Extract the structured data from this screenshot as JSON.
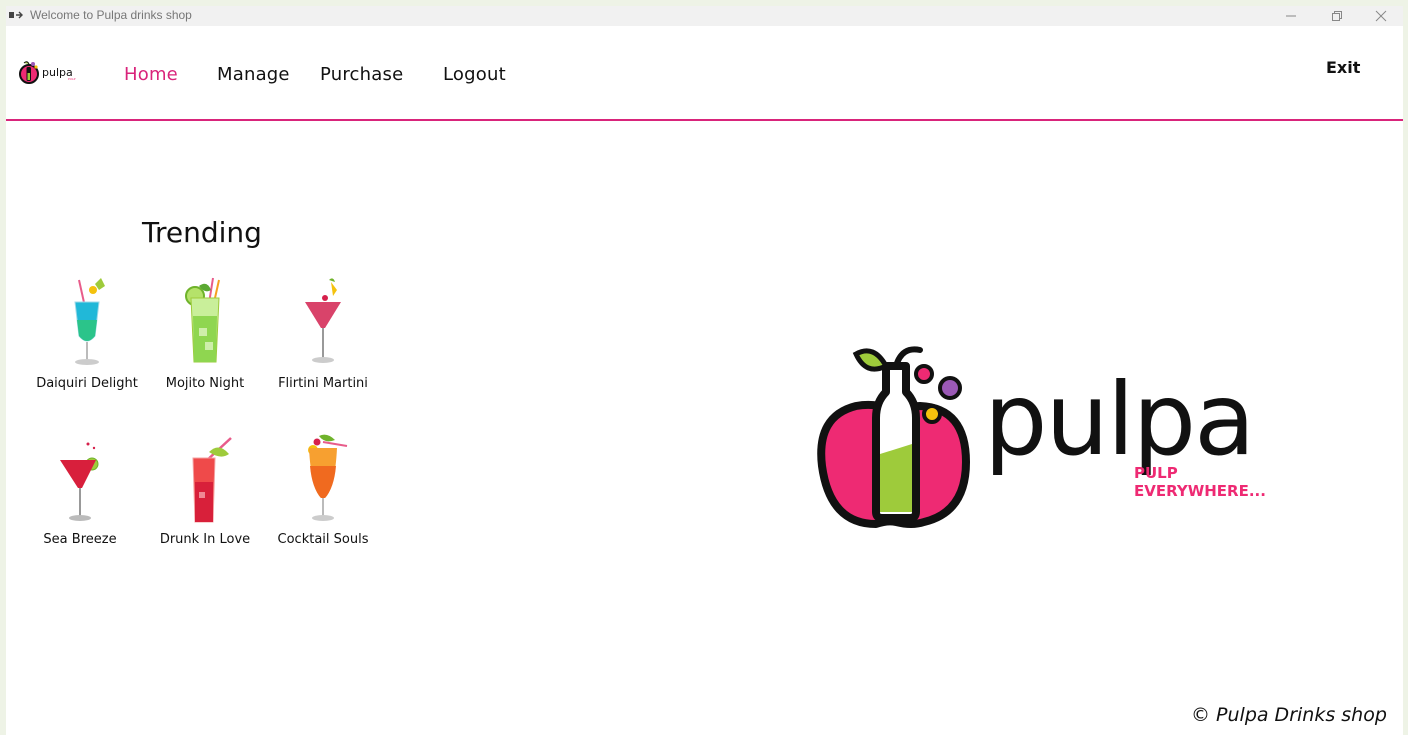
{
  "window": {
    "title": "Welcome to Pulpa drinks shop"
  },
  "nav": {
    "items": [
      {
        "label": "Home",
        "active": true
      },
      {
        "label": "Manage",
        "active": false
      },
      {
        "label": "Purchase",
        "active": false
      },
      {
        "label": "Logout",
        "active": false
      }
    ],
    "exit_label": "Exit"
  },
  "trending": {
    "title": "Trending",
    "drinks": [
      {
        "name": "Daiquiri Delight",
        "icon": "blue-cocktail-icon"
      },
      {
        "name": "Mojito Night",
        "icon": "mojito-icon"
      },
      {
        "name": "Flirtini Martini",
        "icon": "martini-icon"
      },
      {
        "name": "Sea Breeze",
        "icon": "red-martini-icon"
      },
      {
        "name": "Drunk In Love",
        "icon": "red-highball-icon"
      },
      {
        "name": "Cocktail Souls",
        "icon": "orange-cocktail-icon"
      }
    ]
  },
  "brand": {
    "name": "pulpa",
    "tagline_line1": "PULP",
    "tagline_line2": "EVERYWHERE..."
  },
  "footer": {
    "copyright": "© Pulpa Drinks shop"
  },
  "colors": {
    "accent": "#d9247b",
    "brand_pink": "#ee2a73",
    "brand_green": "#9ecb3b",
    "brand_yellow": "#f4c20d",
    "brand_purple": "#9b59b6"
  }
}
